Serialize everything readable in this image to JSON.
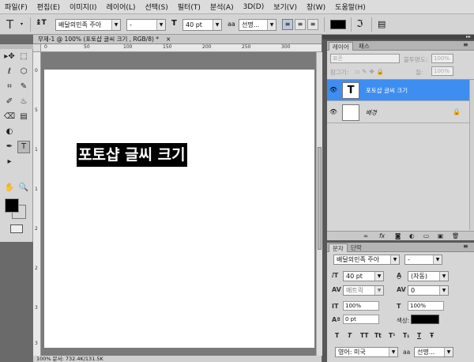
{
  "menu": [
    "파일(F)",
    "편집(E)",
    "이미지(I)",
    "레이어(L)",
    "선택(S)",
    "필터(T)",
    "분석(A)",
    "3D(D)",
    "보기(V)",
    "창(W)",
    "도움말(H)"
  ],
  "options": {
    "tool_glyph": "T",
    "orient_glyph": "↨T",
    "font_family": "배달의민족 주아",
    "font_style": "-",
    "size_glyph": "T",
    "font_size": "40 pt",
    "aa_glyph": "aa",
    "antialias": "선명...",
    "warp_glyph": "ℑ",
    "panel_glyph": "▤",
    "text_color": "#000000"
  },
  "toolbox": {
    "tools": [
      "▸✥",
      "⬚",
      "ℓ",
      "⬡",
      "⌗",
      "✎",
      "✐",
      "♨",
      "⌫",
      "▤",
      "◐",
      "✒",
      "T",
      "▸",
      "✋",
      "🔍"
    ],
    "fg": "#000000",
    "bg": "#ffffff"
  },
  "document": {
    "tab_title": "무제-1 @ 100% (포토샵 글씨 크기 , RGB/8) *",
    "tab_close": "×",
    "type_text": "포토샵 글씨 크기",
    "status": "100%     문서: 732.4K/131.5K",
    "hruler_marks": [
      "0",
      "50",
      "100",
      "150",
      "200",
      "250",
      "300"
    ],
    "vruler_marks": [
      "0",
      "5",
      "1",
      "1",
      "2",
      "2",
      "3",
      "3"
    ]
  },
  "layers_panel": {
    "tabs": [
      "레이어",
      "패스"
    ],
    "blend_mode": "표준",
    "opacity_label": "불투명도:",
    "opacity": "100%",
    "lock_label": "잠그기:",
    "fill_label": "칠:",
    "fill": "100%",
    "layers": [
      {
        "name": "포토샵 글씨 크기",
        "thumb": "T",
        "selected": true,
        "lock": ""
      },
      {
        "name": "배경",
        "thumb": "",
        "selected": false,
        "lock": "🔒"
      }
    ],
    "footer_icons": [
      "∞",
      "fx",
      "◙",
      "◐",
      "▭",
      "▣",
      "🗑"
    ]
  },
  "character_panel": {
    "tabs": [
      "문자",
      "단락"
    ],
    "font_family": "배달의민족 주아",
    "font_style": "-",
    "font_size": "40 pt",
    "leading": "(자동)",
    "kerning": "메트릭",
    "tracking": "0",
    "vscale": "100%",
    "hscale": "100%",
    "baseline": "0 pt",
    "color_label": "색상:",
    "color": "#000000",
    "style_glyphs": [
      "T",
      "T",
      "TT",
      "Tt",
      "T¹",
      "T₁",
      "T",
      "Ŧ"
    ],
    "language": "영어: 미국",
    "antialias": "선명..."
  }
}
